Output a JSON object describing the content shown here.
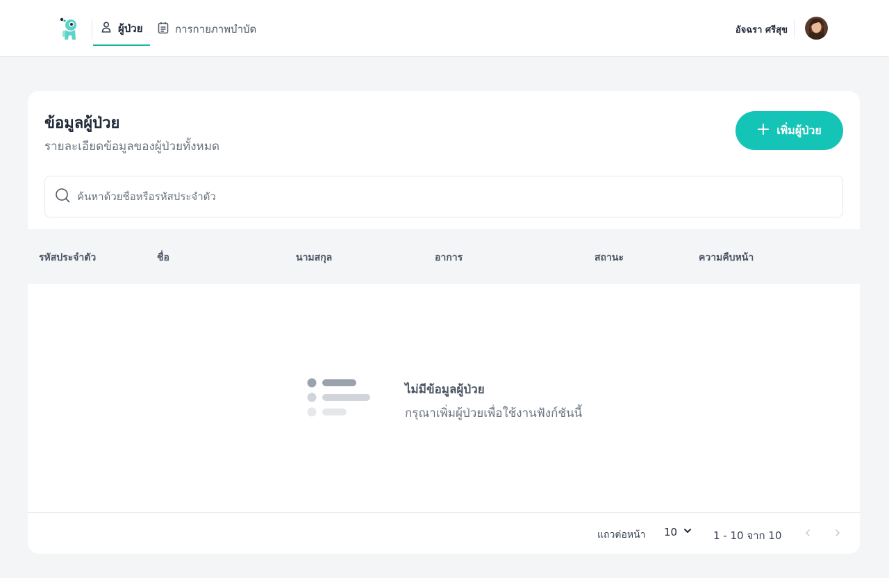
{
  "nav": {
    "tabs": [
      {
        "label": "ผู้ป่วย",
        "icon": "user-icon",
        "active": true
      },
      {
        "label": "การกายภาพบำบัด",
        "icon": "clipboard-icon",
        "active": false
      }
    ],
    "user_name": "อัจฉรา ศรีสุข"
  },
  "header": {
    "title": "ข้อมูลผู้ป่วย",
    "subtitle": "รายละเอียดข้อมูลของผู้ป่วยทั้งหมด",
    "add_button_label": "เพิ่มผู้ป่วย"
  },
  "search": {
    "placeholder": "ค้นหาด้วยชื่อหรือรหัสประจำตัว",
    "value": ""
  },
  "table": {
    "columns": [
      "รหัสประจำตัว",
      "ชื่อ",
      "นามสกุล",
      "อาการ",
      "สถานะ",
      "ความคืบหน้า"
    ],
    "rows": []
  },
  "empty_state": {
    "title": "ไม่มีข้อมูลผู้ป่วย",
    "description": "กรุณาเพิ่มผู้ป่วยเพื่อใช้งานฟังก์ชันนี้"
  },
  "pagination": {
    "rows_per_page_label": "แถวต่อหน้า",
    "rows_per_page_value": "10",
    "range_text": "1 - 10 จาก 10"
  },
  "colors": {
    "accent": "#14c4b6",
    "background": "#f3f5f7"
  }
}
